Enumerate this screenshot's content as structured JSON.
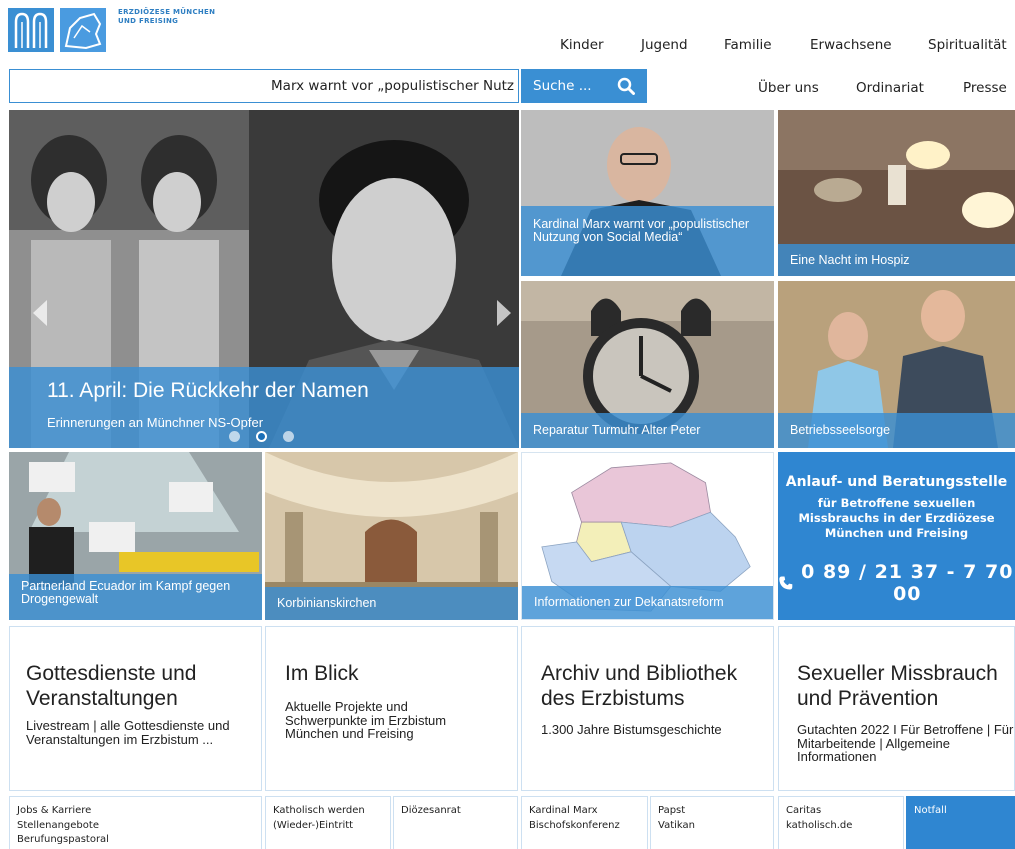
{
  "logo": {
    "line1": "ERZDIÖZESE MÜNCHEN",
    "line2": "UND FREISING"
  },
  "nav_top": [
    "Kinder",
    "Jugend",
    "Familie",
    "Erwachsene",
    "Spiritualität"
  ],
  "nav_second": [
    "Über uns",
    "Ordinariat",
    "Presse"
  ],
  "ticker": "Marx warnt vor „populistischer Nutz",
  "search": {
    "placeholder": "Suche ..."
  },
  "hero": {
    "title": "11. April: Die Rückkehr der Namen",
    "subtitle": "Erinnerungen an Münchner NS-Opfer",
    "slides": 3,
    "active_slide": 2
  },
  "tiles": {
    "marx": "Kardinal Marx warnt vor „populistischer Nutzung von Social Media“",
    "hospiz": "Eine Nacht im Hospiz",
    "turmuhr": "Reparatur Turmuhr Alter Peter",
    "betrieb": "Betriebsseelsorge",
    "ecuador": "Partnerland Ecuador im Kampf gegen Drogengewalt",
    "korbinian": "Korbinianskirchen",
    "dekanat": "Informationen zur Dekanatsreform"
  },
  "infobox": {
    "title": "Anlauf- und Beratungsstelle",
    "line1": "für Betroffene sexuellen",
    "line2": "Missbrauchs in der Erzdiözese",
    "line3": "München und Freising",
    "phone": "0 89 / 21 37 - 7 70 00"
  },
  "boxes": [
    {
      "title": "Gottesdienste und Veranstaltungen",
      "text": "Livestream | alle Gottesdienste und Veranstaltungen im Erzbistum ..."
    },
    {
      "title": "Im Blick",
      "text": "Aktuelle Projekte und Schwerpunkte im Erzbistum München und Freising"
    },
    {
      "title": "Archiv und Bibliothek des Erzbistums",
      "text": "1.300 Jahre Bistumsgeschichte"
    },
    {
      "title": "Sexueller Missbrauch und Prävention",
      "text": "Gutachten 2022 I Für Betroffene | Für Mitarbeitende | Allgemeine Informationen"
    }
  ],
  "links": [
    [
      "Jobs & Karriere",
      "Stellenangebote",
      "Berufungspastoral"
    ],
    [
      "Katholisch werden",
      "(Wieder-)Eintritt"
    ],
    [
      "Diözesanrat"
    ],
    [
      "Kardinal Marx",
      "Bischofskonferenz"
    ],
    [
      "Papst",
      "Vatikan"
    ],
    [
      "Caritas",
      "katholisch.de"
    ],
    [
      "Notfall"
    ]
  ],
  "colors": {
    "accent": "#3a8fd3",
    "info": "#2f86d1"
  }
}
